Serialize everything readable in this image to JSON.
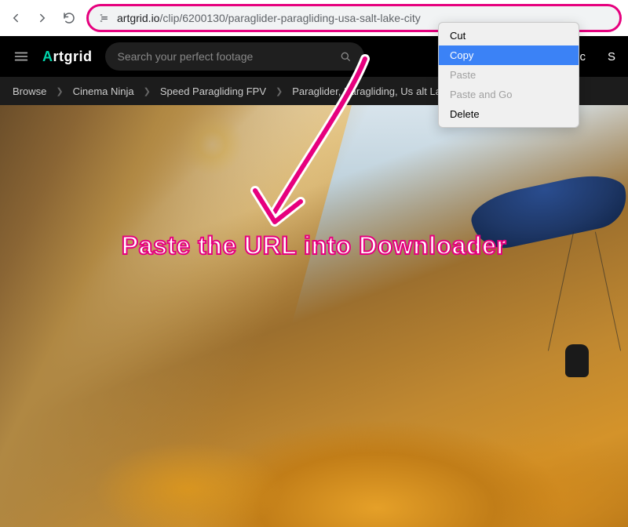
{
  "browser": {
    "url_prefix": "artgrid.io",
    "url_path": "/clip/6200130/paraglider-paragliding-usa-salt-lake-city"
  },
  "context_menu": {
    "items": [
      {
        "label": "Cut",
        "state": "normal"
      },
      {
        "label": "Copy",
        "state": "selected"
      },
      {
        "label": "Paste",
        "state": "disabled"
      },
      {
        "label": "Paste and Go",
        "state": "disabled"
      },
      {
        "label": "Delete",
        "state": "normal"
      }
    ]
  },
  "site": {
    "logo_first": "A",
    "logo_rest": "rtgrid",
    "search_placeholder": "Search your perfect footage",
    "nav_right": [
      "c",
      "S"
    ]
  },
  "breadcrumb": {
    "items": [
      "Browse",
      "Cinema Ninja",
      "Speed Paragliding FPV",
      "Paraglider, Paragliding, Us"
    ],
    "truncated_tail": "alt Lake"
  },
  "annotation": {
    "text": "Paste the URL into Downloader"
  }
}
